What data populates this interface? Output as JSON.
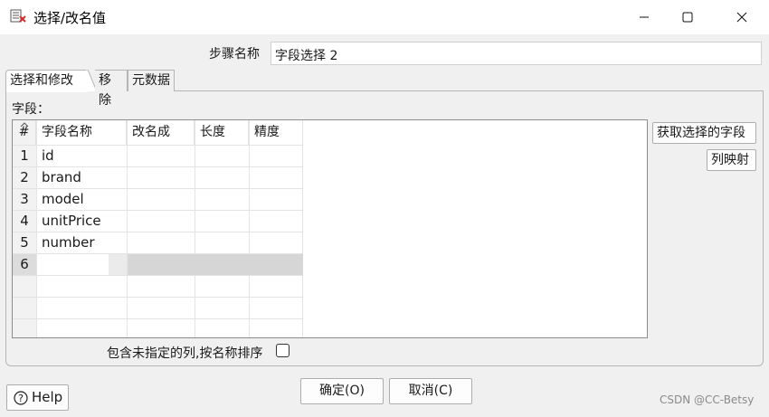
{
  "window": {
    "title": "选择/改名值"
  },
  "step": {
    "label": "步骤名称",
    "value": "字段选择 2"
  },
  "tabs": [
    {
      "label": "选择和修改",
      "active": true
    },
    {
      "label": "移除",
      "active": false
    },
    {
      "label": "元数据",
      "active": false
    }
  ],
  "fields_label": "字段：",
  "table": {
    "columns": [
      "#",
      "字段名称",
      "改名成",
      "长度",
      "精度"
    ],
    "rows": [
      {
        "num": "1",
        "name": "id"
      },
      {
        "num": "2",
        "name": "brand"
      },
      {
        "num": "3",
        "name": "model"
      },
      {
        "num": "4",
        "name": "unitPrice"
      },
      {
        "num": "5",
        "name": "number"
      },
      {
        "num": "6",
        "name": ""
      }
    ]
  },
  "buttons": {
    "get_fields": "获取选择的字段",
    "column_mapping": "列映射",
    "ok": "确定(O)",
    "cancel": "取消(C)",
    "help": "Help"
  },
  "include_unspecified": {
    "label": "包含未指定的列,按名称排序",
    "checked": false
  },
  "watermark": "CSDN @CC-Betsy"
}
